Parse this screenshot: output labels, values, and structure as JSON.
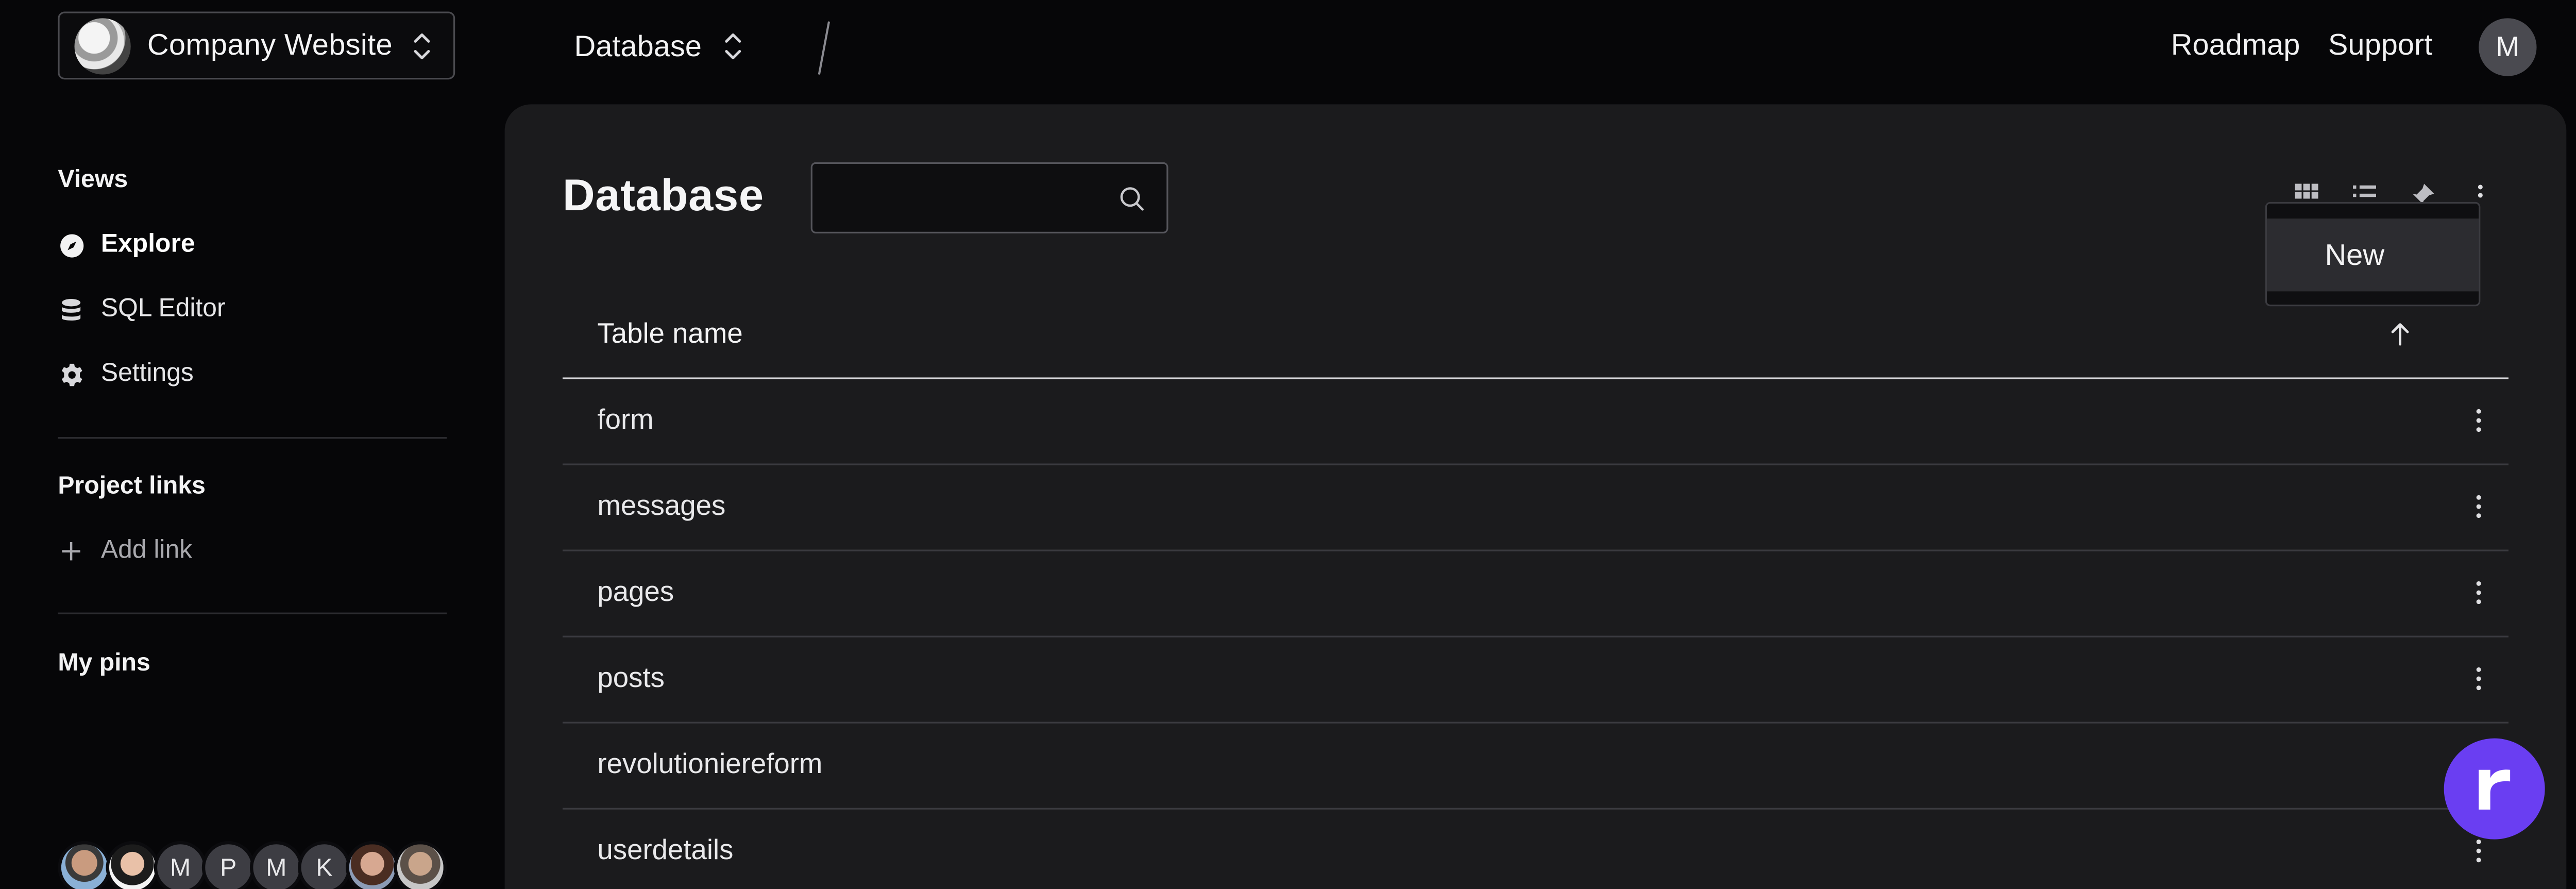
{
  "header": {
    "project_name": "Company Website",
    "database_switch": "Database",
    "links": [
      "Roadmap",
      "Support"
    ],
    "user_initial": "M"
  },
  "sidebar": {
    "views_heading": "Views",
    "items": [
      {
        "label": "Explore",
        "icon": "compass-icon",
        "active": true
      },
      {
        "label": "SQL Editor",
        "icon": "database-icon",
        "active": false
      },
      {
        "label": "Settings",
        "icon": "gear-icon",
        "active": false
      }
    ],
    "project_links_heading": "Project links",
    "add_link_label": "Add link",
    "my_pins_heading": "My pins",
    "collaborators": [
      {
        "type": "photo"
      },
      {
        "type": "photo"
      },
      {
        "type": "initial",
        "label": "M"
      },
      {
        "type": "initial",
        "label": "P"
      },
      {
        "type": "initial",
        "label": "M"
      },
      {
        "type": "initial",
        "label": "K"
      },
      {
        "type": "photo"
      },
      {
        "type": "photo"
      }
    ]
  },
  "main": {
    "title": "Database",
    "search": {
      "value": "",
      "placeholder": ""
    },
    "toolbar_icons": [
      "grid-view-icon",
      "list-view-icon",
      "pin-icon",
      "more-vertical-icon"
    ],
    "dropdown": {
      "items": [
        "New"
      ]
    },
    "table": {
      "column_header": "Table name",
      "sort": "ascending",
      "rows": [
        "form",
        "messages",
        "pages",
        "posts",
        "revolutioniereform",
        "userdetails"
      ]
    }
  },
  "colors": {
    "background": "#060608",
    "panel": "#1b1b1d",
    "accent": "#6a3ef2"
  }
}
